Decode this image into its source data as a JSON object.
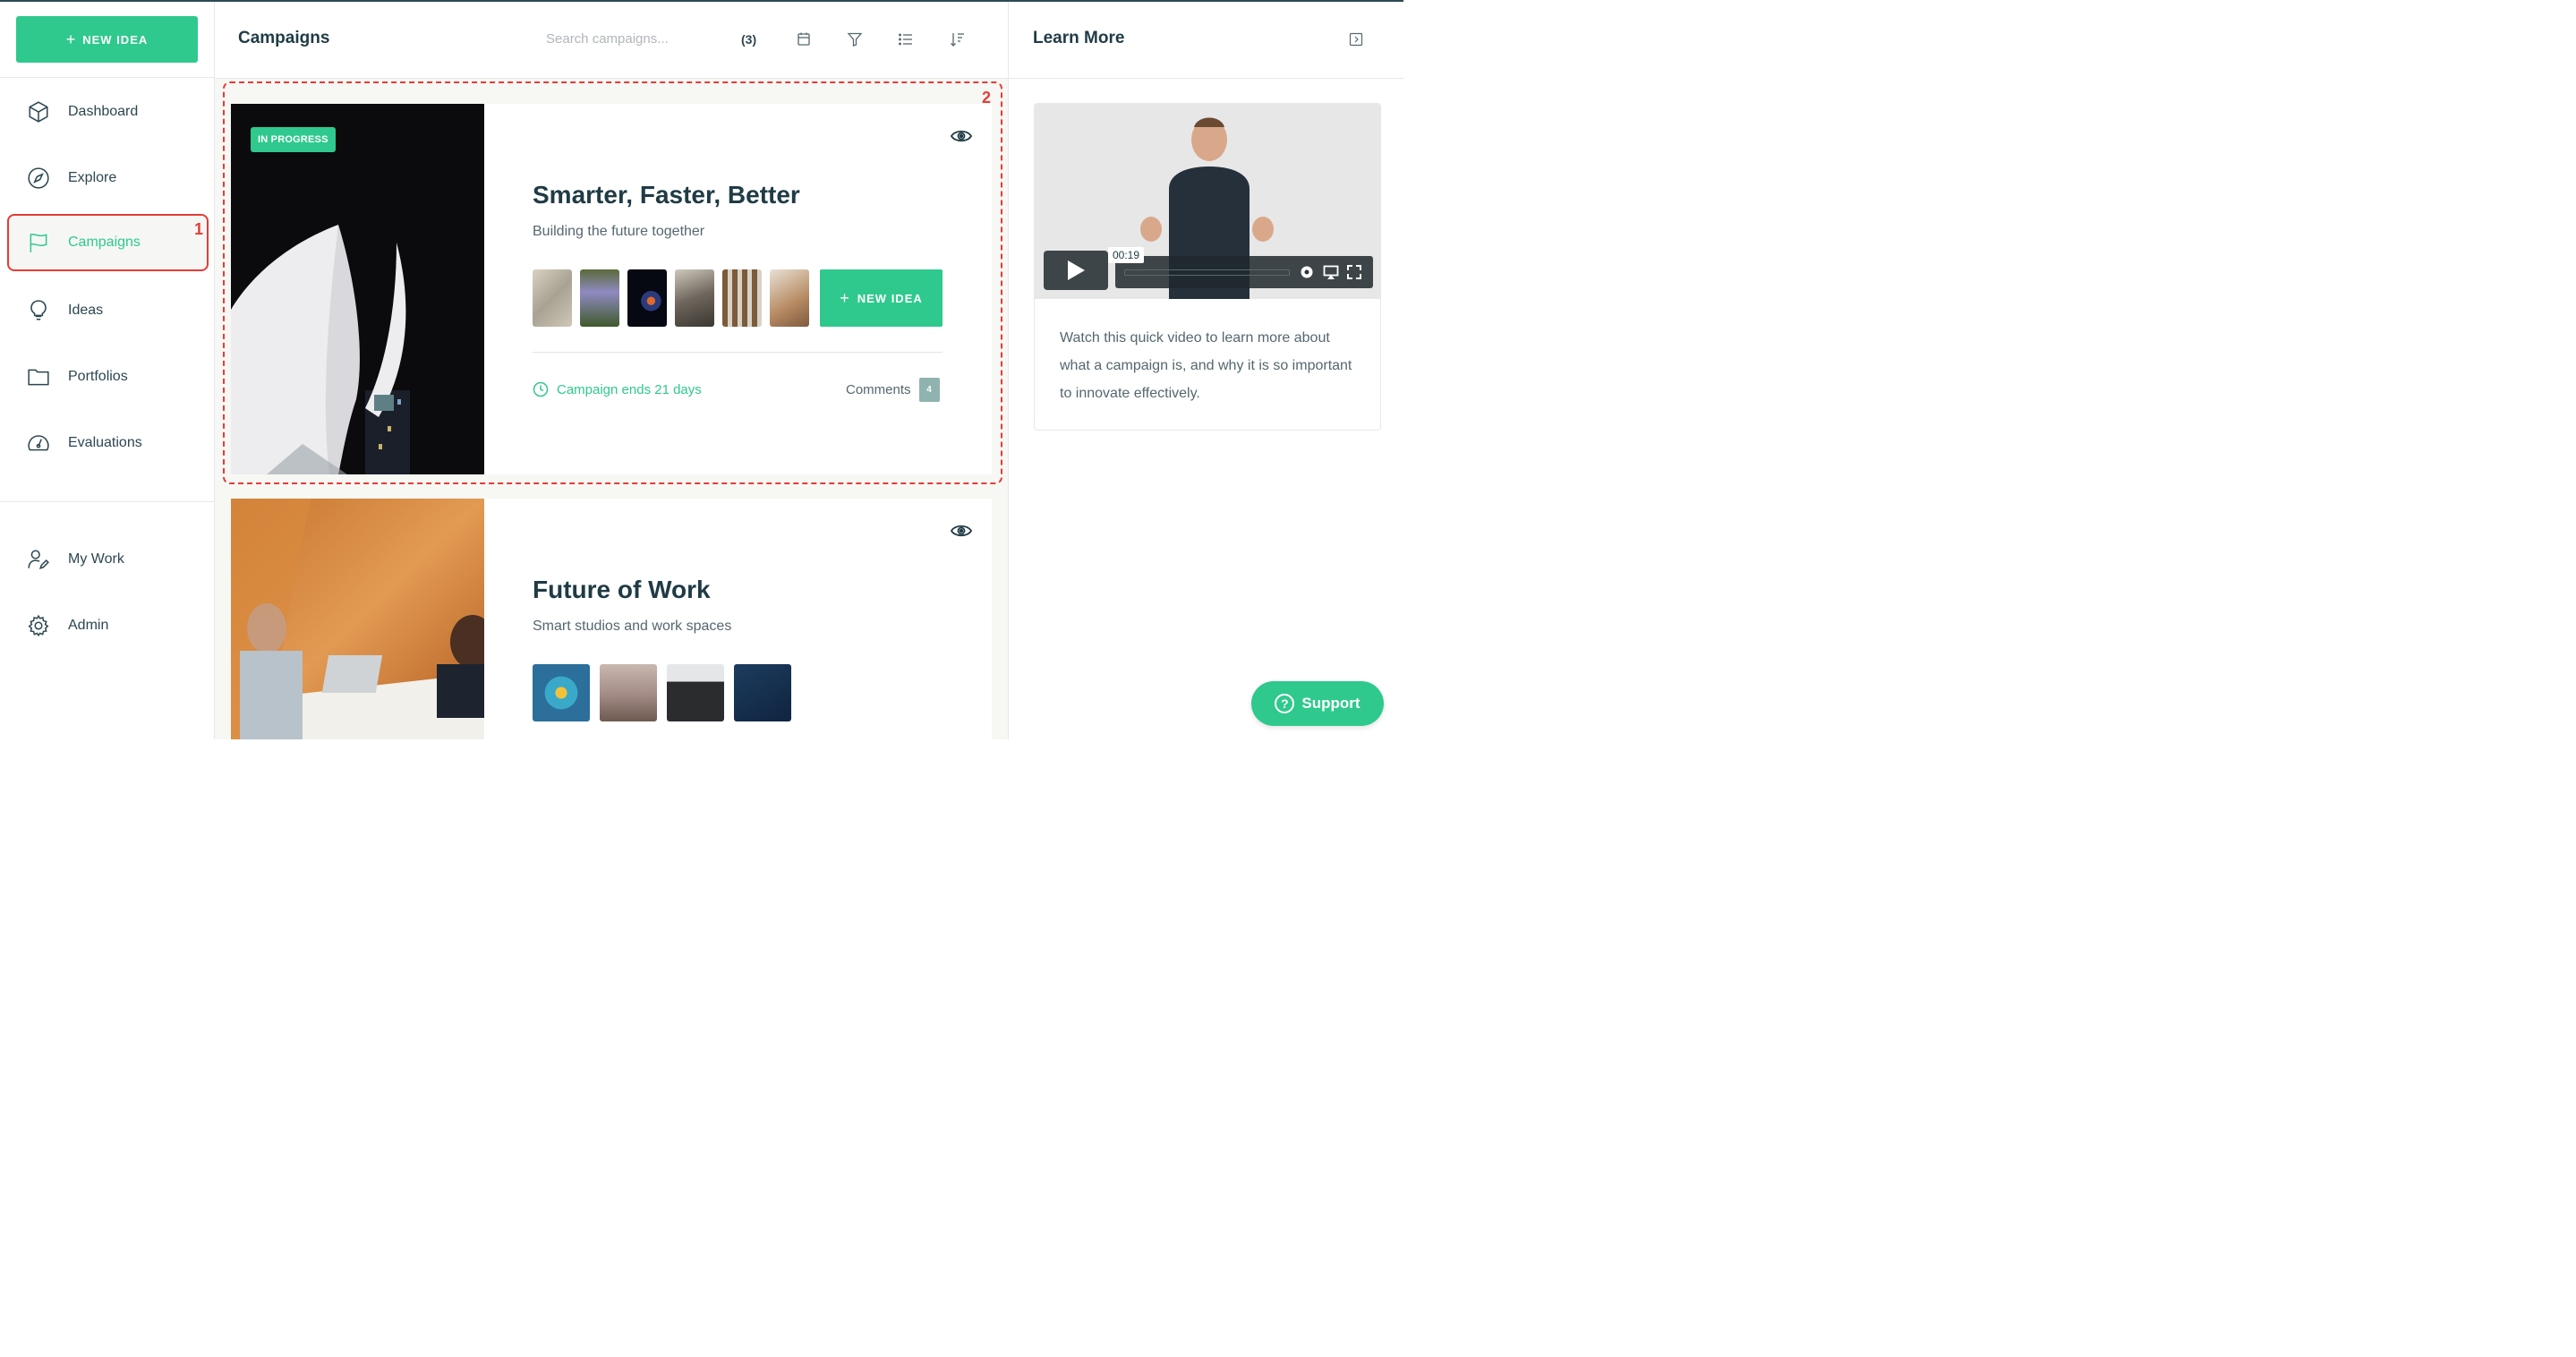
{
  "sidebar": {
    "new_idea": "NEW IDEA",
    "items": [
      {
        "label": "Dashboard"
      },
      {
        "label": "Explore"
      },
      {
        "label": "Campaigns"
      },
      {
        "label": "Ideas"
      },
      {
        "label": "Portfolios"
      },
      {
        "label": "Evaluations"
      }
    ],
    "bottom": [
      {
        "label": "My Work"
      },
      {
        "label": "Admin"
      }
    ]
  },
  "annotations": {
    "first": "1",
    "second": "2"
  },
  "main": {
    "title": "Campaigns",
    "search_placeholder": "Search campaigns...",
    "count": "(3)",
    "cards": [
      {
        "badge": "IN PROGRESS",
        "title": "Smarter, Faster, Better",
        "subtitle": "Building the future together",
        "button": "NEW IDEA",
        "ends": "Campaign ends 21 days",
        "comments_label": "Comments",
        "comments_count": "4"
      },
      {
        "title": "Future of Work",
        "subtitle": "Smart studios and work spaces"
      }
    ]
  },
  "right": {
    "title": "Learn More",
    "video_time": "00:19",
    "video_text": "Watch this quick video to learn more about what a campaign is, and why it is so important to innovate effectively."
  },
  "support": {
    "label": "Support"
  },
  "colors": {
    "accent": "#2fc98d",
    "annotation": "#e63b36",
    "dark": "#1f3b45"
  }
}
